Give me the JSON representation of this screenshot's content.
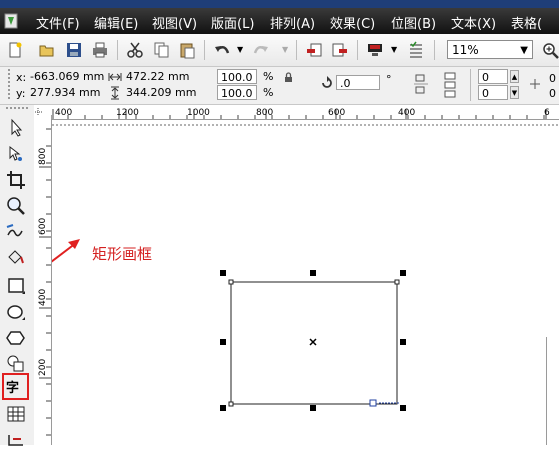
{
  "menu": {
    "items": [
      "文件(F)",
      "编辑(E)",
      "视图(V)",
      "版面(L)",
      "排列(A)",
      "效果(C)",
      "位图(B)",
      "文本(X)",
      "表格("
    ]
  },
  "toolbar": {
    "zoom_value": "11%",
    "icons": [
      "new-document-icon",
      "open-folder-icon",
      "save-icon",
      "print-icon",
      "cut-icon",
      "copy-icon",
      "paste-icon",
      "undo-icon",
      "redo-icon",
      "import-icon",
      "export-icon",
      "application-launcher-icon",
      "options-icon",
      "zoom-icon"
    ]
  },
  "properties": {
    "x_label": "x:",
    "x_value": "-663.069 mm",
    "y_label": "y:",
    "y_value": "277.934 mm",
    "width_value": "472.22 mm",
    "height_value": "344.209 mm",
    "scale_x": "100.0",
    "scale_y": "100.0",
    "percent": "%",
    "rotation": ".0",
    "degree": "°",
    "corner_top": "0",
    "corner_bottom": "0"
  },
  "ruler": {
    "h_labels": [
      "400",
      "1200",
      "1000",
      "800",
      "600",
      "400",
      "6"
    ],
    "v_labels": [
      "800",
      "600",
      "400",
      "200"
    ]
  },
  "toolbox": {
    "text_tool_label": "字",
    "tools": [
      "pick-tool-icon",
      "shape-tool-icon",
      "crop-tool-icon",
      "zoom-tool-icon",
      "freehand-tool-icon",
      "smart-fill-tool-icon",
      "rectangle-tool-icon",
      "ellipse-tool-icon",
      "polygon-tool-icon",
      "basic-shapes-tool-icon",
      "text-tool-icon",
      "table-tool-icon"
    ]
  },
  "annotation": {
    "text": "矩形画框",
    "color": "#d42020"
  }
}
